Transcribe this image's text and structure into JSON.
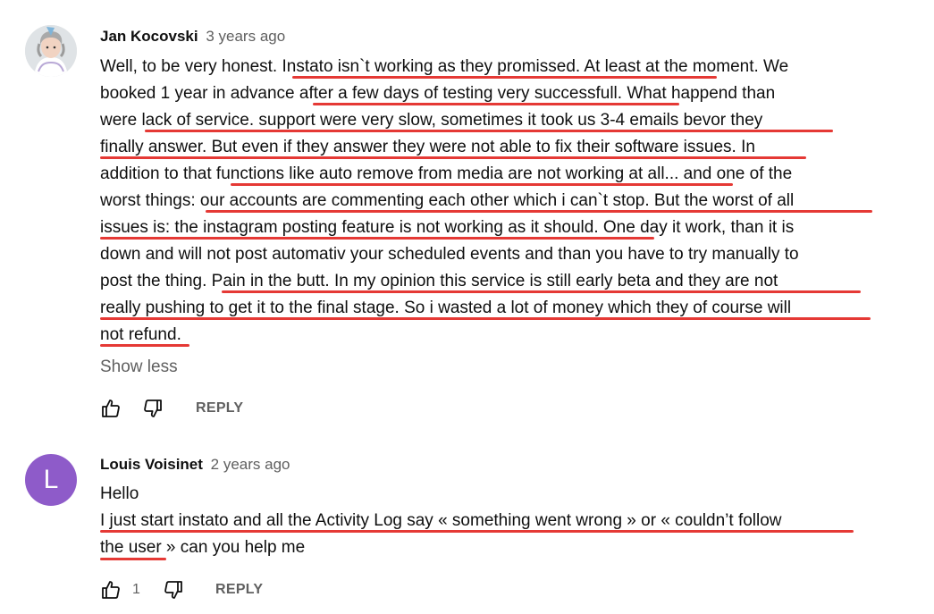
{
  "comments": [
    {
      "author": "Jan Kocovski",
      "time": "3 years ago",
      "avatar_icon": "user-photo-avatar",
      "lines": [
        "Well, to be very honest. Instato isn`t working as they promissed. At least at the moment. We",
        "booked 1 year in advance after a few days of testing very successfull. What happend than",
        "were lack of service. support were very slow, sometimes it took us 3-4 emails bevor they",
        "finally answer. But even if they answer they were not able to fix their software issues. In",
        "addition to that functions like auto remove from media are not working at all... and one of the",
        "worst things: our accounts are commenting each other which i can`t stop. But the worst of all",
        "issues is: the instagram posting feature is not working as it should. One day it work, than it is",
        "down and will not post automativ your scheduled events and than you have to try manually to",
        "post the thing. Pain in the butt. In my opinion this service is still early beta and they are not",
        "really pushing to get it to the final stage. So i wasted a lot of money which they of course will",
        "not refund."
      ],
      "show_less": "Show less",
      "like_count": "",
      "reply_label": "REPLY"
    },
    {
      "author": "Louis Voisinet",
      "time": "2 years ago",
      "avatar_letter": "L",
      "lines": [
        "Hello",
        "I just start instato and all the Activity Log say « something went wrong » or « couldn’t follow",
        "the user » can you help me"
      ],
      "like_count": "1",
      "reply_label": "REPLY"
    }
  ],
  "colors": {
    "underline": "#e53935",
    "avatar_l": "#8e5bc9",
    "secondary_text": "#606060"
  },
  "icons": [
    "thumb-up-icon",
    "thumb-down-icon"
  ]
}
